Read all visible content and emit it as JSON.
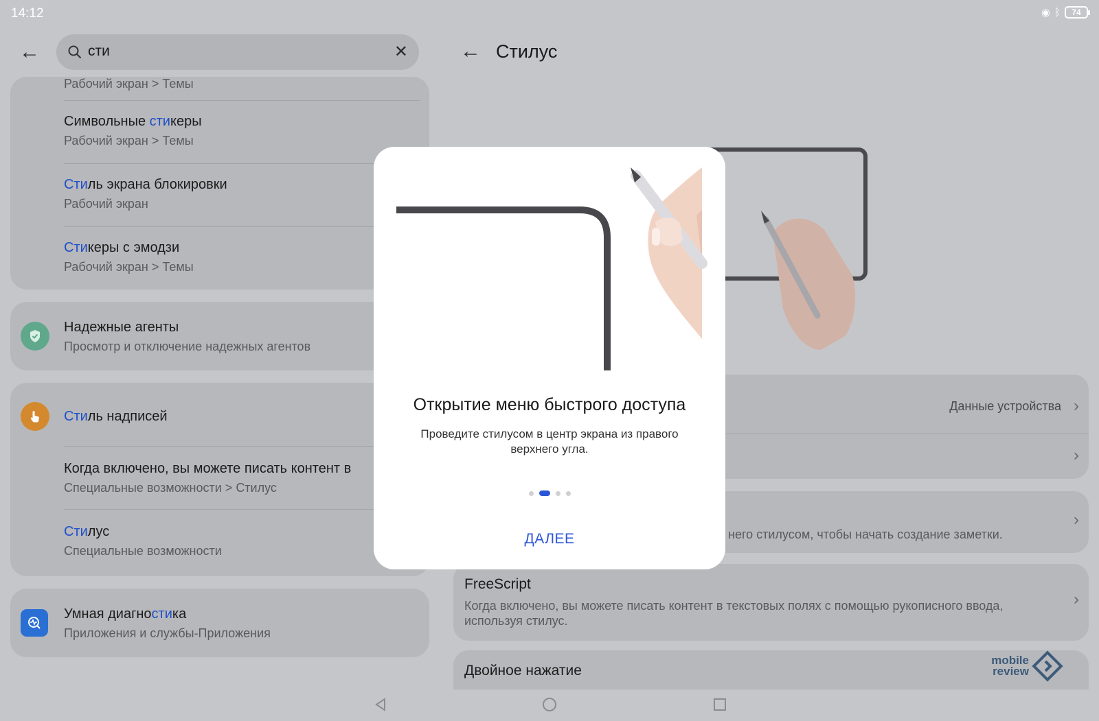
{
  "status_bar": {
    "time": "14:12",
    "battery": "74"
  },
  "search": {
    "query": "сти"
  },
  "results": {
    "partial_sub": "Рабочий экран > Темы",
    "items": [
      {
        "title_pre": "Символьные ",
        "title_hl": "сти",
        "title_post": "керы",
        "sub": "Рабочий экран > Темы"
      },
      {
        "title_pre": "",
        "title_hl": "Сти",
        "title_post": "ль экрана блокировки",
        "sub": "Рабочий экран"
      },
      {
        "title_pre": "",
        "title_hl": "Сти",
        "title_post": "керы с эмодзи",
        "sub": "Рабочий экран > Темы"
      }
    ],
    "agents": {
      "title": "Надежные агенты",
      "sub": "Просмотр и отключение надежных агентов"
    },
    "handwriting": {
      "title_hl": "Сти",
      "title_post": "ль надписей"
    },
    "handwriting_items": [
      {
        "title_pre": "Когда включено, вы можете писать контент в",
        "title_hl": "",
        "title_post": "",
        "sub": "Специальные возможности > Стилус"
      },
      {
        "title_pre": "",
        "title_hl": "Сти",
        "title_post": "лус",
        "sub": "Специальные возможности"
      }
    ],
    "diagnostics": {
      "title_pre": "Умная диагно",
      "title_hl": "сти",
      "title_post": "ка",
      "sub": "Приложения и службы-Приложения"
    }
  },
  "right": {
    "title": "Стилус",
    "device_info": "Данные устройства",
    "note_partial": "него стилусом, чтобы начать создание заметки.",
    "freescript": {
      "title": "FreeScript",
      "sub": "Когда включено, вы можете писать контент в текстовых полях с помощью рукописного ввода, используя стилус."
    },
    "double_tap": {
      "title": "Двойное нажатие"
    }
  },
  "dialog": {
    "title": "Открытие меню быстрого доступа",
    "text": "Проведите стилусом в центр экрана из правого верхнего угла.",
    "button": "ДАЛЕЕ",
    "page_current": 2,
    "page_total": 4
  },
  "watermark": {
    "line1": "mobile",
    "line2": "review"
  },
  "colors": {
    "accent": "#2b56d6",
    "highlight": "#1f4fc9",
    "agent_icon": "#5fa88c",
    "handwriting_icon": "#d4892e",
    "diag_icon": "#2a6fd4"
  }
}
